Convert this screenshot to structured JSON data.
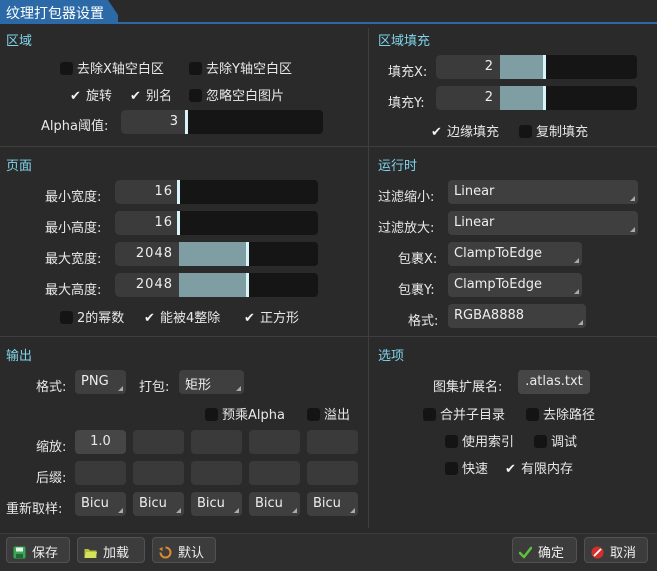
{
  "window": {
    "title": "纹理打包器设置"
  },
  "region": {
    "title": "区域",
    "strip_x": {
      "label": "去除X轴空白区",
      "checked": false
    },
    "strip_y": {
      "label": "去除Y轴空白区",
      "checked": false
    },
    "rotation": {
      "label": "旋转",
      "checked": true
    },
    "alias": {
      "label": "别名",
      "checked": true
    },
    "ignore_blank": {
      "label": "忽略空白图片",
      "checked": false
    },
    "alpha_threshold": {
      "label": "Alpha阈值:",
      "value": "3"
    }
  },
  "padding": {
    "title": "区域填充",
    "pad_x": {
      "label": "填充X:",
      "value": "2"
    },
    "pad_y": {
      "label": "填充Y:",
      "value": "2"
    },
    "edge_padding": {
      "label": "边缘填充",
      "checked": true
    },
    "duplicate_padding": {
      "label": "复制填充",
      "checked": false
    }
  },
  "page": {
    "title": "页面",
    "min_width": {
      "label": "最小宽度:",
      "value": "16"
    },
    "min_height": {
      "label": "最小高度:",
      "value": "16"
    },
    "max_width": {
      "label": "最大宽度:",
      "value": "2048"
    },
    "max_height": {
      "label": "最大高度:",
      "value": "2048"
    },
    "pot": {
      "label": "2的幂数",
      "checked": false
    },
    "multiple_of_four": {
      "label": "能被4整除",
      "checked": true
    },
    "square": {
      "label": "正方形",
      "checked": true
    }
  },
  "runtime": {
    "title": "运行时",
    "filter_min": {
      "label": "过滤缩小:",
      "value": "Linear"
    },
    "filter_mag": {
      "label": "过滤放大:",
      "value": "Linear"
    },
    "wrap_x": {
      "label": "包裹X:",
      "value": "ClampToEdge"
    },
    "wrap_y": {
      "label": "包裹Y:",
      "value": "ClampToEdge"
    },
    "format": {
      "label": "格式:",
      "value": "RGBA8888"
    }
  },
  "output": {
    "title": "输出",
    "format_label": "格式:",
    "format_value": "PNG",
    "packing_label": "打包:",
    "packing_value": "矩形",
    "premultiply": {
      "label": "预乘Alpha",
      "checked": false
    },
    "bleed": {
      "label": "溢出",
      "checked": false
    },
    "scale_label": "缩放:",
    "scale_values": [
      "1.0",
      "",
      "",
      "",
      ""
    ],
    "suffix_label": "后缀:",
    "suffix_values": [
      "",
      "",
      "",
      "",
      ""
    ],
    "resample_label": "重新取样:",
    "resample_values": [
      "Bicu",
      "Bicu",
      "Bicu",
      "Bicu",
      "Bicu"
    ]
  },
  "options": {
    "title": "选项",
    "atlas_ext_label": "图集扩展名:",
    "atlas_ext_value": ".atlas.txt",
    "combine_subdirs": {
      "label": "合并子目录",
      "checked": false
    },
    "flatten_paths": {
      "label": "去除路径",
      "checked": false
    },
    "use_indexes": {
      "label": "使用索引",
      "checked": false
    },
    "debug": {
      "label": "调试",
      "checked": false
    },
    "fast": {
      "label": "快速",
      "checked": false
    },
    "limit_memory": {
      "label": "有限内存",
      "checked": true
    }
  },
  "buttons": {
    "save": "保存",
    "load": "加载",
    "default": "默认",
    "ok": "确定",
    "cancel": "取消"
  },
  "colors": {
    "accent": "#2b6aa6",
    "section_title": "#7fd3ea",
    "slider_fill": "#7e9ea4",
    "background": "#2a2a2a"
  }
}
